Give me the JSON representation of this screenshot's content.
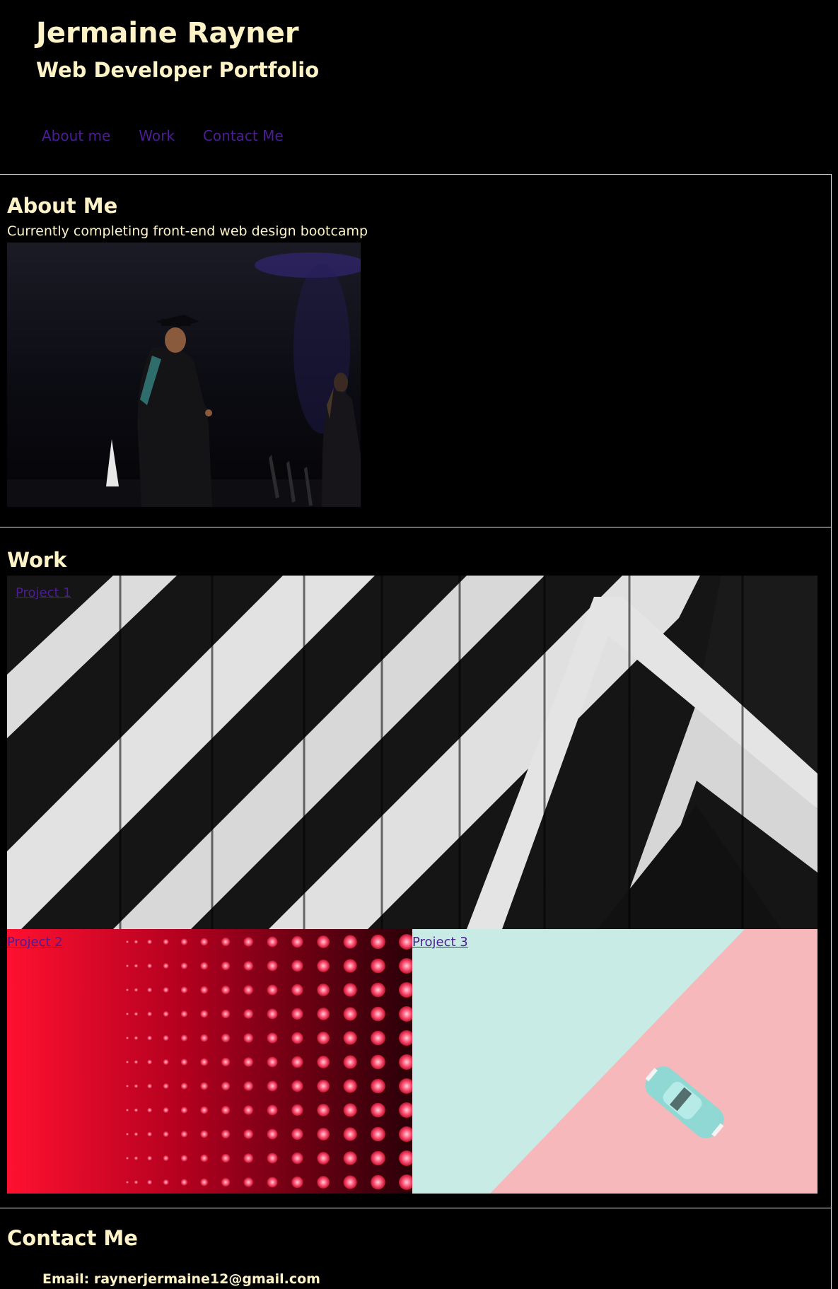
{
  "header": {
    "name": "Jermaine Rayner",
    "tagline": "Web Developer Portfolio"
  },
  "nav": {
    "items": [
      {
        "label": "About me"
      },
      {
        "label": "Work"
      },
      {
        "label": "Contact Me"
      }
    ]
  },
  "about": {
    "heading": "About Me",
    "text": "Currently completing front-end web design bootcamp"
  },
  "work": {
    "heading": "Work",
    "projects": [
      {
        "label": "Project 1"
      },
      {
        "label": "Project 2"
      },
      {
        "label": "Project 3"
      }
    ]
  },
  "contact": {
    "heading": "Contact Me",
    "email_line": "Email: raynerjermaine12@gmail.com"
  },
  "colors": {
    "background": "#000000",
    "text": "#fef3c7",
    "link": "#4c1d95",
    "section_border": "#e5e5e5"
  }
}
